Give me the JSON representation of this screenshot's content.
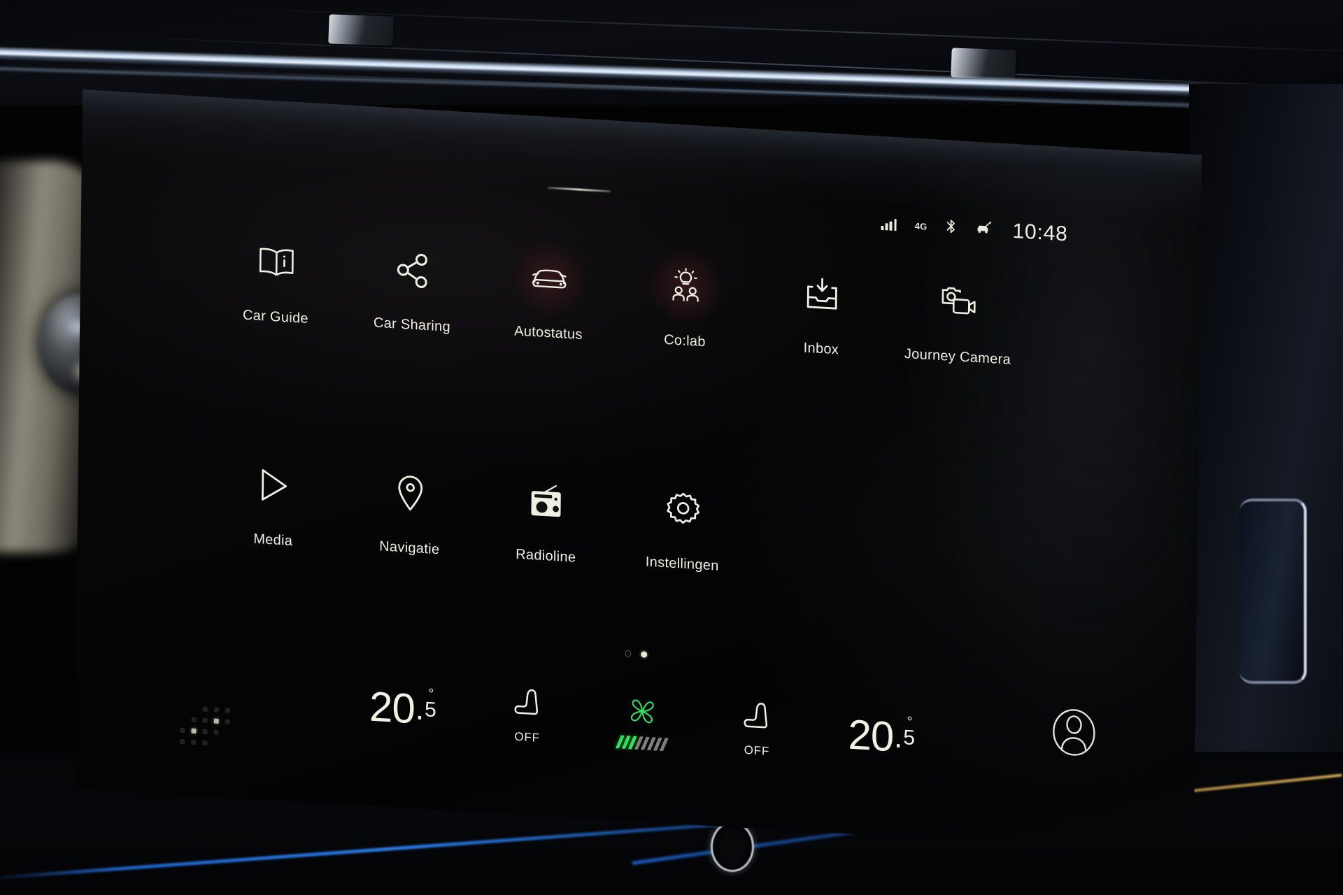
{
  "status_bar": {
    "signal_icon": "cellular-signal-icon",
    "signal_bars": 4,
    "network": "4G",
    "bluetooth_icon": "bluetooth-icon",
    "car_connected_icon": "connected-car-icon",
    "time": "10:48"
  },
  "apps": {
    "row1": [
      {
        "label": "Car Guide",
        "icon": "book-info-icon",
        "tinted": false
      },
      {
        "label": "Car Sharing",
        "icon": "share-nodes-icon",
        "tinted": false
      },
      {
        "label": "Autostatus",
        "icon": "car-front-icon",
        "tinted": true
      },
      {
        "label": "Co:lab",
        "icon": "lightbulb-people-icon",
        "tinted": true
      },
      {
        "label": "Inbox",
        "icon": "inbox-download-icon",
        "tinted": false
      },
      {
        "label": "Journey Camera",
        "icon": "photo-video-camera-icon",
        "tinted": false
      }
    ],
    "row2": [
      {
        "label": "Media",
        "icon": "play-triangle-icon",
        "tinted": false
      },
      {
        "label": "Navigatie",
        "icon": "map-pin-icon",
        "tinted": false
      },
      {
        "label": "Radioline",
        "icon": "radio-icon",
        "tinted": false
      },
      {
        "label": "Instellingen",
        "icon": "gear-icon",
        "tinted": false
      }
    ]
  },
  "pagination": {
    "pages": 2,
    "active_page": 2
  },
  "climate": {
    "left_temperature": {
      "integer": "20",
      "separator": ".",
      "fraction": "5",
      "degree": "°"
    },
    "left_seat": {
      "icon": "seat-heater-icon",
      "state": "OFF"
    },
    "fan": {
      "icon": "fan-blades-icon",
      "level": 3,
      "max_level": 8,
      "color": "#2fe05d"
    },
    "right_seat": {
      "icon": "seat-heater-icon",
      "state": "OFF"
    },
    "right_temperature": {
      "integer": "20",
      "separator": ".",
      "fraction": "5",
      "degree": "°"
    }
  },
  "profile": {
    "icon": "user-avatar-icon"
  },
  "theme": {
    "screen_background": "#050506",
    "text_color": "#eeefe2",
    "accent_green": "#2fe05d",
    "tint_circle": "#481e22",
    "ambient_blue": "#2a80f0"
  }
}
